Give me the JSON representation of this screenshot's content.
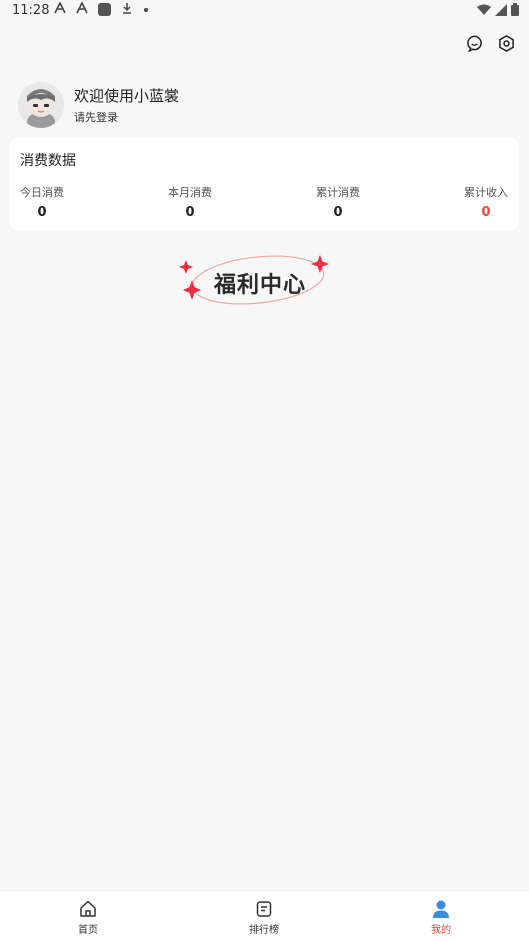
{
  "status_bar": {
    "time": "11:28",
    "left_icons": [
      "A-icon",
      "A-icon",
      "square-icon",
      "download-icon",
      "dot-icon"
    ],
    "right_icons": [
      "wifi-icon",
      "signal-icon",
      "battery-icon"
    ]
  },
  "header": {
    "actions": [
      "message-icon",
      "settings-icon"
    ]
  },
  "profile": {
    "welcome": "欢迎使用小蓝裳",
    "login_hint": "请先登录"
  },
  "consumption": {
    "title": "消费数据",
    "stats": [
      {
        "label": "今日消费",
        "value": "0"
      },
      {
        "label": "本月消费",
        "value": "0"
      },
      {
        "label": "累计消费",
        "value": "0"
      },
      {
        "label": "累计收入",
        "value": "0"
      }
    ],
    "accent_color": "#e5483a"
  },
  "welfare": {
    "label": "福利中心"
  },
  "tabbar": {
    "items": [
      {
        "label": "首页",
        "icon": "home-icon"
      },
      {
        "label": "排行榜",
        "icon": "list-icon"
      },
      {
        "label": "我的",
        "icon": "user-icon",
        "active": true
      }
    ],
    "active_color": "#e5483a",
    "active_icon_color": "#3d8be0"
  }
}
